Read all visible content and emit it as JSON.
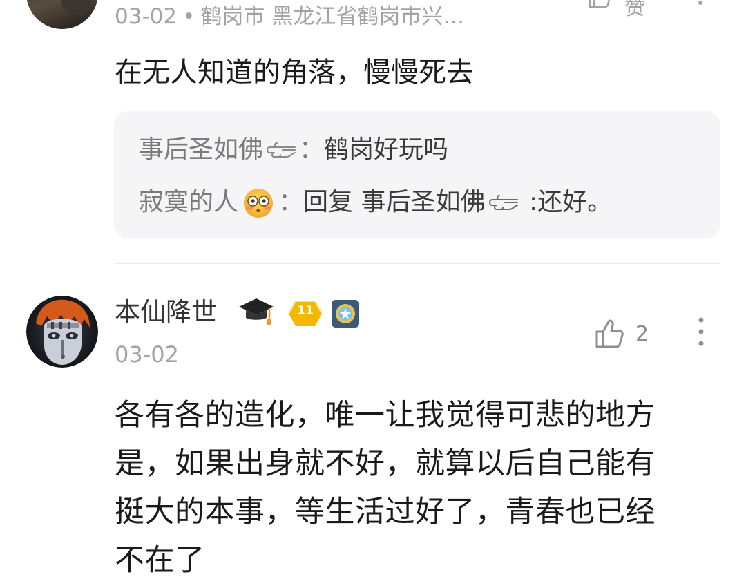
{
  "comment_top": {
    "date": "03-02",
    "separator": "•",
    "location": "鹤岗市 黑龙江省鹤岗市兴…",
    "like_label": "赞",
    "content": "在无人知道的角落，慢慢死去",
    "replies": [
      {
        "author": "事后圣如佛",
        "emoji": "backhand-index-pointing-left",
        "colon": "：",
        "text": "鹤岗好玩吗"
      },
      {
        "author": "寂寞的人",
        "emoji": "flushed-face",
        "colon": "：",
        "reply_prefix": "回复 ",
        "reply_to": "事后圣如佛",
        "reply_to_emoji": "backhand-index-pointing-left",
        "text": " :还好。"
      }
    ]
  },
  "comment_2": {
    "username": "本仙降世",
    "username_emoji": "graduation-cap",
    "level": "11",
    "date": "03-02",
    "like_count": "2",
    "content_lines": [
      "各有各的造化，唯一让我觉得可悲的地方",
      "是，如果出身就不好，就算以后自己能有",
      "挺大的本事，等生活过好了，青春也已经",
      "不在了"
    ]
  },
  "colors": {
    "meta_gray": "#a3a3a3",
    "reply_bg": "#f5f5f7",
    "level_badge": "#f5b800",
    "divider": "#ededed"
  }
}
